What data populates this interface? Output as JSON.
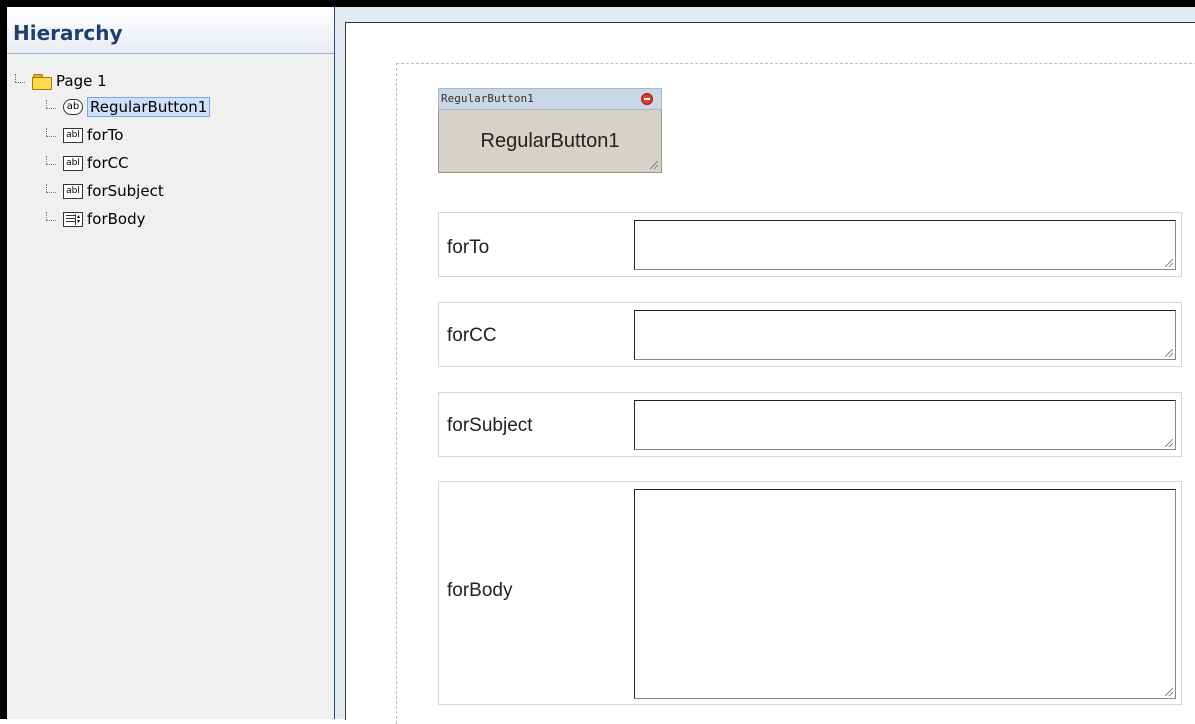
{
  "hierarchy": {
    "title": "Hierarchy",
    "root": {
      "label": "Page 1",
      "icon": "folder-icon"
    },
    "items": [
      {
        "label": "RegularButton1",
        "icon": "button-icon",
        "selected": true
      },
      {
        "label": "forTo",
        "icon": "textbox-icon"
      },
      {
        "label": "forCC",
        "icon": "textbox-icon"
      },
      {
        "label": "forSubject",
        "icon": "textbox-icon"
      },
      {
        "label": "forBody",
        "icon": "textarea-icon"
      }
    ],
    "icon_glyphs": {
      "button": "ab",
      "textbox": "abl"
    }
  },
  "canvas": {
    "button_widget": {
      "title": "RegularButton1",
      "label": "RegularButton1"
    },
    "fields": [
      {
        "label": "forTo",
        "value": ""
      },
      {
        "label": "forCC",
        "value": ""
      },
      {
        "label": "forSubject",
        "value": ""
      },
      {
        "label": "forBody",
        "value": ""
      }
    ]
  },
  "colors": {
    "header_text": "#1f3f6e",
    "selection": "#cfe0fb",
    "button_face": "#d6d2c9",
    "widget_titlebar": "#c9d8e4",
    "remove": "#e23a2b"
  }
}
